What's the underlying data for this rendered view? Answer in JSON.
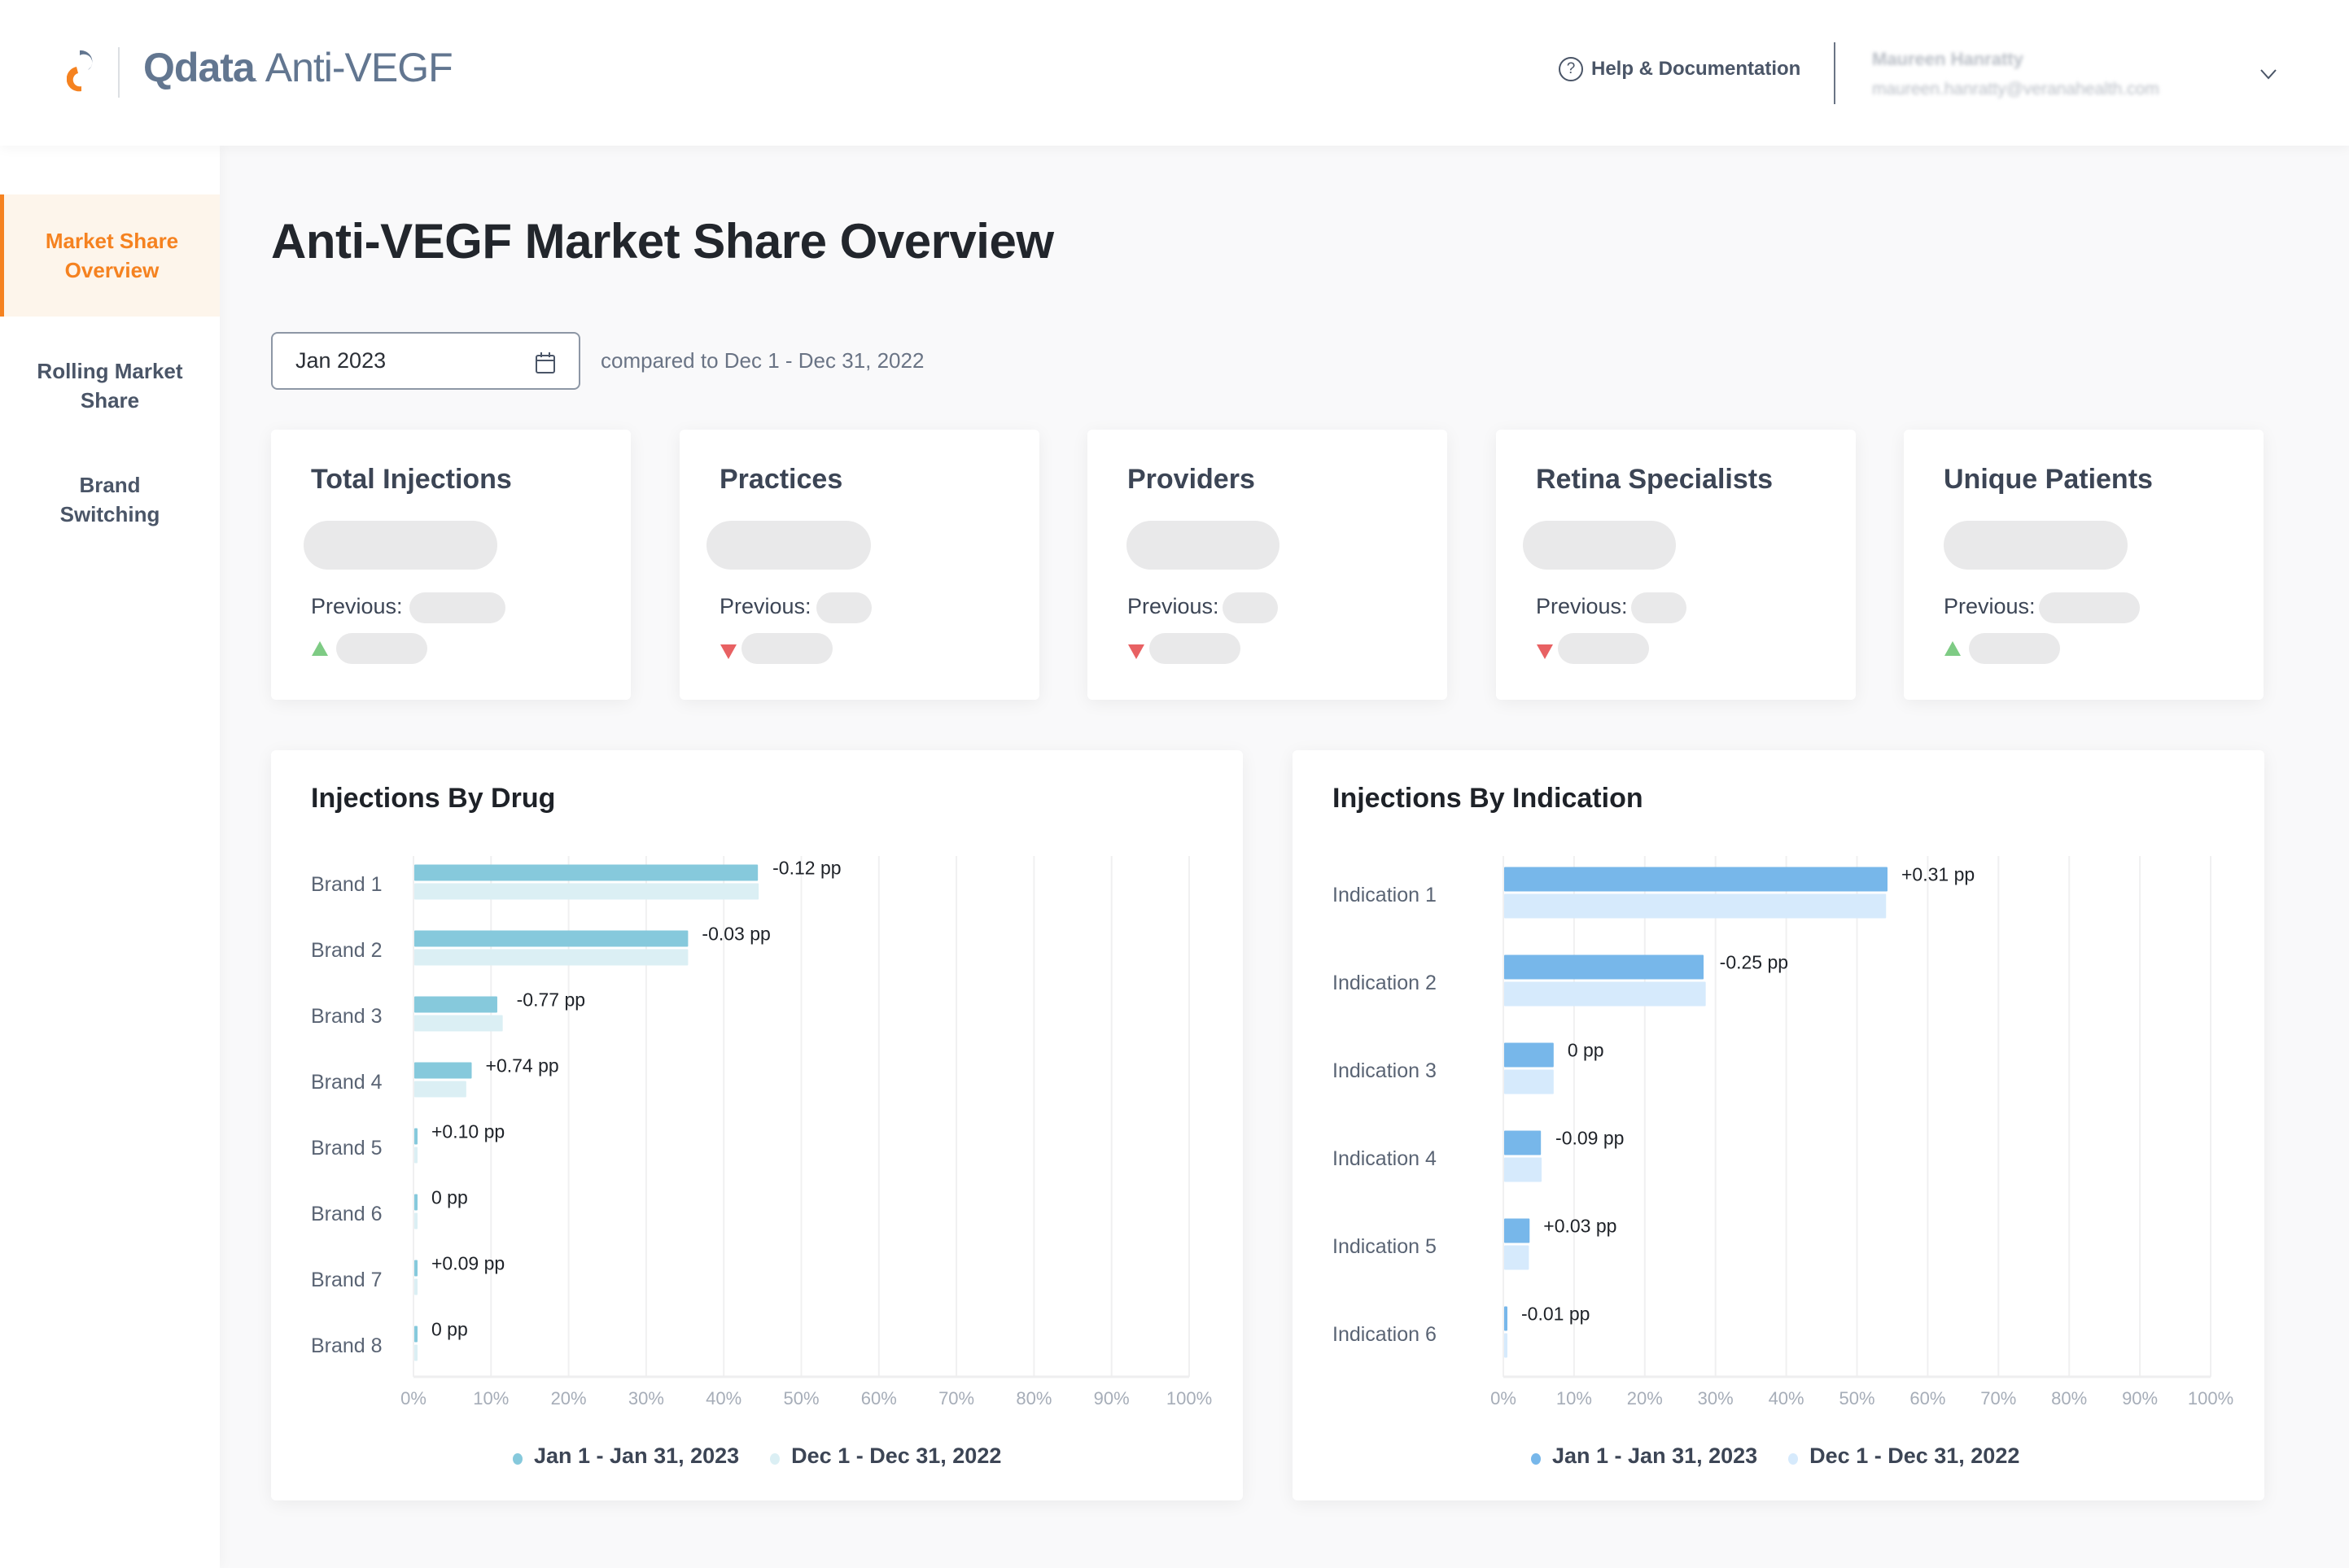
{
  "app": {
    "brand_q": "Q",
    "brand_name": "data",
    "product": "Anti-VEGF"
  },
  "header": {
    "help_label": "Help & Documentation",
    "help_icon": "question-circle-icon",
    "user_name": "Maureen Hanratty",
    "user_email": "maureen.hanratty@veranahealth.com",
    "user_menu_icon": "chevron-down-icon"
  },
  "sidebar": {
    "items": [
      {
        "label": "Market Share Overview",
        "active": true
      },
      {
        "label": "Rolling Market Share",
        "active": false
      },
      {
        "label": "Brand Switching",
        "active": false
      }
    ]
  },
  "page": {
    "title": "Anti-VEGF Market Share Overview",
    "date_value": "Jan 2023",
    "date_icon": "calendar-icon",
    "compare_text": "compared to Dec 1 - Dec 31, 2022"
  },
  "kpis": [
    {
      "title": "Total Injections",
      "previous_label": "Previous:",
      "trend": "up"
    },
    {
      "title": "Practices",
      "previous_label": "Previous:",
      "trend": "down"
    },
    {
      "title": "Providers",
      "previous_label": "Previous:",
      "trend": "down"
    },
    {
      "title": "Retina Specialists",
      "previous_label": "Previous:",
      "trend": "down"
    },
    {
      "title": "Unique Patients",
      "previous_label": "Previous:",
      "trend": "up"
    }
  ],
  "colors": {
    "accent": "#f58220",
    "trend_up": "#7ecb84",
    "trend_down": "#e86163",
    "drug_current": "#86c9dc",
    "drug_previous": "#dbeff4",
    "indication_current": "#77b7ea",
    "indication_previous": "#d6eafc"
  },
  "chart_data": [
    {
      "type": "bar",
      "orientation": "horizontal",
      "title": "Injections By Drug",
      "categories": [
        "Brand 1",
        "Brand 2",
        "Brand 3",
        "Brand 4",
        "Brand 5",
        "Brand 6",
        "Brand 7",
        "Brand 8"
      ],
      "series": [
        {
          "name": "Jan 1 - Jan 31, 2023",
          "values": [
            44.3,
            35.3,
            10.7,
            7.4,
            0.4,
            0.4,
            0.4,
            0.4
          ]
        },
        {
          "name": "Dec 1 - Dec 31, 2022",
          "values": [
            44.4,
            35.3,
            11.4,
            6.7,
            0.3,
            0.4,
            0.3,
            0.4
          ]
        }
      ],
      "annotations": [
        "-0.12 pp",
        "-0.03 pp",
        "-0.77 pp",
        "+0.74 pp",
        "+0.10 pp",
        "0 pp",
        "+0.09 pp",
        "0 pp"
      ],
      "xticks": [
        "0%",
        "10%",
        "20%",
        "30%",
        "40%",
        "50%",
        "60%",
        "70%",
        "80%",
        "90%",
        "100%"
      ],
      "xlim": [
        0,
        100
      ],
      "xlabel": "",
      "ylabel": "",
      "grid": true,
      "legend": "bottom-center"
    },
    {
      "type": "bar",
      "orientation": "horizontal",
      "title": "Injections By Indication",
      "categories": [
        "Indication 1",
        "Indication 2",
        "Indication 3",
        "Indication 4",
        "Indication 5",
        "Indication 6"
      ],
      "series": [
        {
          "name": "Jan 1 - Jan 31, 2023",
          "values": [
            54.2,
            28.2,
            7.0,
            5.2,
            3.6,
            0.4
          ]
        },
        {
          "name": "Dec 1 - Dec 31, 2022",
          "values": [
            54.0,
            28.5,
            7.0,
            5.3,
            3.5,
            0.4
          ]
        }
      ],
      "annotations": [
        "+0.31 pp",
        "-0.25 pp",
        "0 pp",
        "-0.09 pp",
        "+0.03 pp",
        "-0.01 pp"
      ],
      "xticks": [
        "0%",
        "10%",
        "20%",
        "30%",
        "40%",
        "50%",
        "60%",
        "70%",
        "80%",
        "90%",
        "100%"
      ],
      "xlim": [
        0,
        100
      ],
      "xlabel": "",
      "ylabel": "",
      "grid": true,
      "legend": "bottom-center"
    }
  ]
}
